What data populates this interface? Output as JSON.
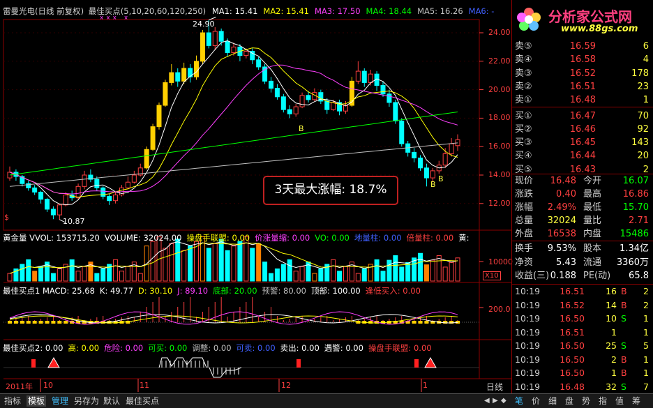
{
  "header": {
    "stock": "雷曼光电(日线 前复权)",
    "indicator": "最佳买点(5,10,20,60,120,250)",
    "ma": [
      {
        "label": "MA1: 15.41",
        "color": "#ffffff"
      },
      {
        "label": "MA2: 15.41",
        "color": "#ffff00"
      },
      {
        "label": "MA3: 17.50",
        "color": "#ff40ff"
      },
      {
        "label": "MA4: 18.44",
        "color": "#00ff00"
      },
      {
        "label": "MA5: 16.26",
        "color": "#c0c0c0"
      },
      {
        "label": "MA6: -",
        "color": "#4060ff"
      }
    ]
  },
  "logo": {
    "title": "分析家公式网",
    "url": "www.88gs.com"
  },
  "price_axis": [
    "24.00",
    "22.00",
    "20.00",
    "18.00",
    "16.00",
    "14.00",
    "12.00"
  ],
  "annotations": {
    "high": "24.90",
    "low": "10.87",
    "callout": "3天最大涨幅: 18.7%",
    "b_marks": [
      "B",
      "B",
      "B"
    ],
    "dollar": "$"
  },
  "volume_panel": {
    "header": [
      {
        "text": "黄金量 VVOL: 153715.20",
        "color": "#ffffff"
      },
      {
        "text": "VOLUME: 32024.00",
        "color": "#ffffff"
      },
      {
        "text": "操盘手联盟: 0.00",
        "color": "#ffff00"
      },
      {
        "text": "价涨量缩: 0.00",
        "color": "#ff40ff"
      },
      {
        "text": "VO: 0.00",
        "color": "#00ff00"
      },
      {
        "text": "地量柱: 0.00",
        "color": "#4060ff"
      },
      {
        "text": "倍量柱: 0.00",
        "color": "#ff4040"
      },
      {
        "text": "黄:",
        "color": "#ffffff"
      }
    ],
    "axis_label": "10000",
    "unit": "X10"
  },
  "macd_panel": {
    "header": [
      {
        "text": "最佳买点1 MACD: 25.68",
        "color": "#ffffff"
      },
      {
        "text": "K: 49.77",
        "color": "#ffffff"
      },
      {
        "text": "D: 30.10",
        "color": "#ffff00"
      },
      {
        "text": "J: 89.10",
        "color": "#ff40ff"
      },
      {
        "text": "底部: 20.00",
        "color": "#00ff00"
      },
      {
        "text": "预警: 80.00",
        "color": "#c0c0c0"
      },
      {
        "text": "顶部: 100.00",
        "color": "#ffffff"
      },
      {
        "text": "逢低买入: 0.00",
        "color": "#ff4040"
      }
    ],
    "axis_label": "200.0"
  },
  "signal_panel": {
    "header": [
      {
        "text": "最佳买点2: 0.00",
        "color": "#ffffff"
      },
      {
        "text": "高: 0.00",
        "color": "#ffff00"
      },
      {
        "text": "危险: 0.00",
        "color": "#ff40ff"
      },
      {
        "text": "可买: 0.00",
        "color": "#00ff00"
      },
      {
        "text": "调整: 0.00",
        "color": "#c0c0c0"
      },
      {
        "text": "可卖: 0.00",
        "color": "#4060ff"
      },
      {
        "text": "卖出: 0.00",
        "color": "#ffffff"
      },
      {
        "text": "遇警: 0.00",
        "color": "#ffffff"
      },
      {
        "text": "操盘手联盟: 0.00",
        "color": "#ff4040"
      }
    ]
  },
  "date_axis": {
    "labels": [
      "2011年",
      "10",
      "11",
      "12",
      "1"
    ],
    "period": "日线"
  },
  "order_book": [
    {
      "label": "卖⑤",
      "price": "16.59",
      "vol": "6"
    },
    {
      "label": "卖④",
      "price": "16.58",
      "vol": "4"
    },
    {
      "label": "卖③",
      "price": "16.52",
      "vol": "178"
    },
    {
      "label": "卖②",
      "price": "16.51",
      "vol": "23"
    },
    {
      "label": "卖①",
      "price": "16.48",
      "vol": "1"
    },
    {
      "label": "买①",
      "price": "16.47",
      "vol": "70"
    },
    {
      "label": "买②",
      "price": "16.46",
      "vol": "92"
    },
    {
      "label": "买③",
      "price": "16.45",
      "vol": "143"
    },
    {
      "label": "买④",
      "price": "16.44",
      "vol": "20"
    },
    {
      "label": "买⑤",
      "price": "16.43",
      "vol": "2"
    }
  ],
  "stats": [
    {
      "l1": "现价",
      "v1": "16.48",
      "c1": "#ff4040",
      "l2": "今开",
      "v2": "16.07",
      "c2": "#00ff00"
    },
    {
      "l1": "涨跌",
      "v1": "0.40",
      "c1": "#ff4040",
      "l2": "最高",
      "v2": "16.86",
      "c2": "#ff4040"
    },
    {
      "l1": "涨幅",
      "v1": "2.49%",
      "c1": "#ff4040",
      "l2": "最低",
      "v2": "15.70",
      "c2": "#00ff00"
    },
    {
      "l1": "总量",
      "v1": "32024",
      "c1": "#ffff40",
      "l2": "量比",
      "v2": "2.71",
      "c2": "#ff4040"
    },
    {
      "l1": "外盘",
      "v1": "16538",
      "c1": "#ff4040",
      "l2": "内盘",
      "v2": "15486",
      "c2": "#00ff00"
    }
  ],
  "stats2": [
    {
      "l1": "换手",
      "v1": "9.53%",
      "l2": "股本",
      "v2": "1.34亿"
    },
    {
      "l1": "净资",
      "v1": "5.43",
      "l2": "流通",
      "v2": "3360万"
    },
    {
      "l1": "收益(三)",
      "v1": "0.188",
      "l2": "PE(动)",
      "v2": "65.8"
    }
  ],
  "ticks": [
    {
      "time": "10:19",
      "price": "16.51",
      "vol": "16",
      "side": "B",
      "n": "2",
      "sc": "#ff4040"
    },
    {
      "time": "10:19",
      "price": "16.52",
      "vol": "14",
      "side": "B",
      "n": "2",
      "sc": "#ff4040"
    },
    {
      "time": "10:19",
      "price": "16.50",
      "vol": "10",
      "side": "S",
      "n": "1",
      "sc": "#00ff00"
    },
    {
      "time": "10:19",
      "price": "16.51",
      "vol": "1",
      "side": "",
      "n": "1",
      "sc": "#ff4040"
    },
    {
      "time": "10:19",
      "price": "16.50",
      "vol": "25",
      "side": "S",
      "n": "5",
      "sc": "#00ff00"
    },
    {
      "time": "10:19",
      "price": "16.50",
      "vol": "2",
      "side": "B",
      "n": "1",
      "sc": "#ff4040"
    },
    {
      "time": "10:19",
      "price": "16.50",
      "vol": "1",
      "side": "B",
      "n": "1",
      "sc": "#ff4040"
    },
    {
      "time": "10:19",
      "price": "16.48",
      "vol": "32",
      "side": "S",
      "n": "7",
      "sc": "#00ff00"
    }
  ],
  "bottom_tabs": [
    "指标",
    "模板",
    "管理",
    "另存为",
    "默认",
    "最佳买点"
  ],
  "right_tabs": [
    "笔",
    "价",
    "细",
    "盘",
    "势",
    "指",
    "值",
    "筹"
  ],
  "colors": {
    "up": "#ff4040",
    "down": "#00ffff",
    "bg": "#000000",
    "grid": "#8b0000"
  }
}
